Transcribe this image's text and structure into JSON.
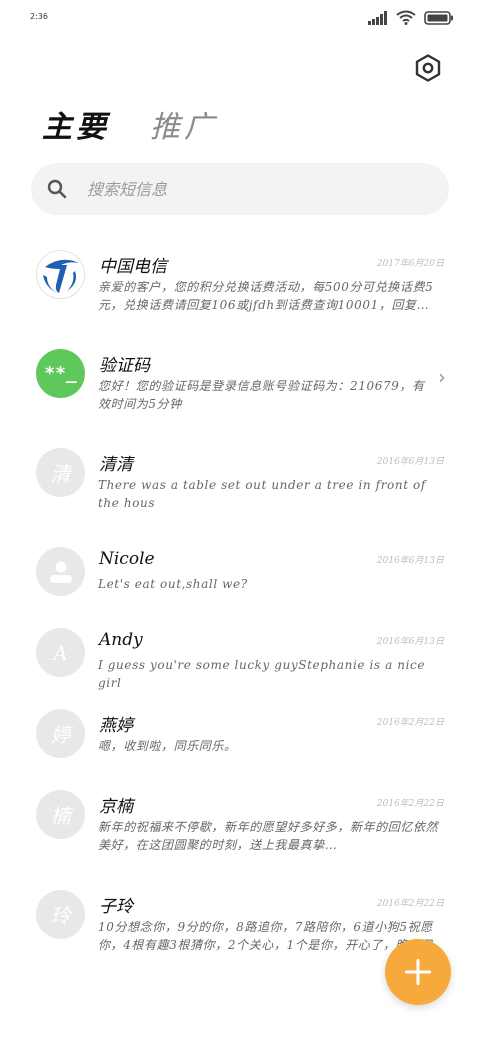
{
  "status_bar": {
    "time": "2:36",
    "icons": [
      "signal-icon",
      "wifi-icon",
      "battery-icon"
    ]
  },
  "header": {
    "settings_icon": "gear-icon"
  },
  "tabs": [
    {
      "label": "主要",
      "active": true
    },
    {
      "label": "推广",
      "active": false
    }
  ],
  "search": {
    "placeholder": "搜索短信息",
    "icon": "search-icon"
  },
  "messages": [
    {
      "sender": "中国电信",
      "date": "2017年6月20日",
      "preview": "亲爱的客户，您的积分兑换话费活动，每500分可兑换话费5元，兑换话费请回复106或jfdh到话费查询10001，回复…",
      "avatar": {
        "type": "logo",
        "color": "#1e5fb3"
      }
    },
    {
      "sender": "验证码",
      "date": "",
      "preview": "您好！您的验证码是登录信息账号验证码为：210679，有效时间为5分钟",
      "avatar": {
        "type": "text",
        "text": "**_",
        "color": "#5fc85a"
      },
      "chevron": true
    },
    {
      "sender": "清清",
      "date": "2016年6月13日",
      "preview": "There was a table set out under a tree in front of the hous",
      "avatar": {
        "type": "text",
        "text": "清",
        "color": "#e8e8ea"
      }
    },
    {
      "sender": "Nicole",
      "date": "2016年6月13日",
      "preview": "Let's eat out,shall we?",
      "avatar": {
        "type": "person",
        "color": "#e8e8ea"
      }
    },
    {
      "sender": "Andy",
      "date": "2016年6月13日",
      "preview": "I guess you're some lucky guyStephanie is a nice girl",
      "avatar": {
        "type": "text",
        "text": "A",
        "color": "#e8e8ea"
      }
    },
    {
      "sender": "燕婷",
      "date": "2016年2月22日",
      "preview": "嗯，收到啦，同乐同乐。",
      "avatar": {
        "type": "text",
        "text": "婷",
        "color": "#e8e8ea"
      }
    },
    {
      "sender": "京楠",
      "date": "2016年2月22日",
      "preview": "新年的祝福来不停歇，新年的愿望好多好多，新年的回忆依然美好，在这团圆聚的时刻，送上我最真挚…",
      "avatar": {
        "type": "text",
        "text": "楠",
        "color": "#e8e8ea"
      }
    },
    {
      "sender": "子玲",
      "date": "2016年2月22日",
      "preview": "10分想念你，9分的你，8路追你，7路陪你，6道小狗5祝愿你，4根有趣3根猜你，2个关心，1个是你，开心了，晚上见",
      "avatar": {
        "type": "text",
        "text": "玲",
        "color": "#e8e8ea"
      }
    }
  ],
  "fab": {
    "icon": "plus-icon",
    "color": "#f7a93b"
  }
}
